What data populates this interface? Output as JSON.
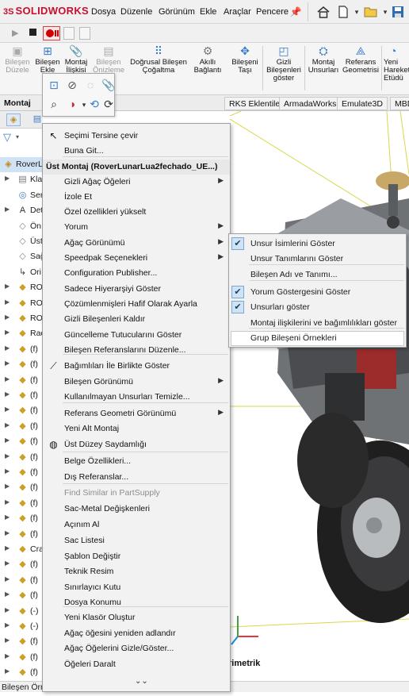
{
  "app": {
    "logo_brand": "SOLIDWORKS",
    "logo_prefix": "3S"
  },
  "menubar": [
    "Dosya",
    "Düzenle",
    "Görünüm",
    "Ekle",
    "Araçlar",
    "Pencere"
  ],
  "commands": [
    {
      "label": "Bileşen Düzele",
      "disabled": true,
      "icon": "component-edit-icon"
    },
    {
      "label": "Bileşen Ekle",
      "disabled": false,
      "icon": "insert-component-icon"
    },
    {
      "label": "Montaj İlişkisi",
      "disabled": false,
      "icon": "mate-icon"
    },
    {
      "label": "Bileşen Önizleme",
      "disabled": true,
      "icon": "preview-icon"
    },
    {
      "label": "Doğrusal Bileşen Çoğaltma",
      "disabled": false,
      "icon": "linear-pattern-icon"
    },
    {
      "label": "Akıllı Bağlantı",
      "disabled": false,
      "icon": "smart-fastener-icon"
    },
    {
      "label": "Bileşeni Taşı",
      "disabled": false,
      "icon": "move-component-icon"
    },
    {
      "label": "Gizli Bileşenleri göster",
      "disabled": false,
      "icon": "show-hidden-icon"
    },
    {
      "label": "Montaj Unsurları",
      "disabled": false,
      "icon": "assembly-feature-icon"
    },
    {
      "label": "Referans Geometrisi",
      "disabled": false,
      "icon": "reference-geometry-icon"
    },
    {
      "label": "Yeni Hareket Etüdü",
      "disabled": false,
      "icon": "motion-study-icon"
    }
  ],
  "tabs": [
    "Montaj",
    "RKS Eklentileri",
    "ArmadaWorks",
    "Emulate3D",
    "MBD"
  ],
  "tree": [
    {
      "label": "RoverL",
      "icon": "assembly-icon",
      "expand": ""
    },
    {
      "label": "Kla",
      "icon": "folder-icon",
      "expand": "▶"
    },
    {
      "label": "Ser",
      "icon": "sensor-icon",
      "expand": ""
    },
    {
      "label": "Det",
      "icon": "annotation-icon",
      "expand": "▶"
    },
    {
      "label": "Ön",
      "icon": "plane-icon",
      "expand": ""
    },
    {
      "label": "Üst",
      "icon": "plane-icon",
      "expand": ""
    },
    {
      "label": "Sağ",
      "icon": "plane-icon",
      "expand": ""
    },
    {
      "label": "Ori",
      "icon": "origin-icon",
      "expand": ""
    },
    {
      "label": "RO",
      "icon": "part-icon",
      "expand": "▶"
    },
    {
      "label": "RO",
      "icon": "part-icon",
      "expand": "▶"
    },
    {
      "label": "RO",
      "icon": "part-icon",
      "expand": "▶"
    },
    {
      "label": "Rac",
      "icon": "part-icon",
      "expand": "▶"
    },
    {
      "label": "(f)",
      "icon": "part-icon",
      "expand": "▶"
    },
    {
      "label": "(f)",
      "icon": "part-icon",
      "expand": "▶"
    },
    {
      "label": "(f)",
      "icon": "part-icon",
      "expand": "▶"
    },
    {
      "label": "(f)",
      "icon": "part-icon",
      "expand": "▶"
    },
    {
      "label": "(f)",
      "icon": "part-icon",
      "expand": "▶"
    },
    {
      "label": "(f)",
      "icon": "part-icon",
      "expand": "▶"
    },
    {
      "label": "(f)",
      "icon": "part-icon",
      "expand": "▶"
    },
    {
      "label": "(f)",
      "icon": "part-icon",
      "expand": "▶"
    },
    {
      "label": "(f)",
      "icon": "part-icon",
      "expand": "▶"
    },
    {
      "label": "(f)",
      "icon": "part-icon",
      "expand": "▶"
    },
    {
      "label": "(f)",
      "icon": "part-icon",
      "expand": "▶"
    },
    {
      "label": "(f)",
      "icon": "part-icon",
      "expand": "▶"
    },
    {
      "label": "(f)",
      "icon": "part-icon",
      "expand": "▶"
    },
    {
      "label": "Cra",
      "icon": "part-icon",
      "expand": "▶"
    },
    {
      "label": "(f)",
      "icon": "part-icon",
      "expand": "▶"
    },
    {
      "label": "(f)",
      "icon": "part-icon",
      "expand": "▶"
    },
    {
      "label": "(f)",
      "icon": "part-icon",
      "expand": "▶"
    },
    {
      "label": "(-)",
      "icon": "part-icon",
      "expand": "▶"
    },
    {
      "label": "(-)",
      "icon": "part-icon",
      "expand": "▶"
    },
    {
      "label": "(f)",
      "icon": "part-icon",
      "expand": "▶"
    },
    {
      "label": "(f)",
      "icon": "part-icon",
      "expand": "▶"
    },
    {
      "label": "(f)",
      "icon": "part-icon",
      "expand": "▶"
    },
    {
      "label": "(f)",
      "icon": "part-icon",
      "expand": "▶"
    }
  ],
  "context_menu": {
    "items": [
      {
        "label": "Seçimi Tersine çevir",
        "icon": "cursor-icon"
      },
      {
        "label": "Buna Git...",
        "icon": ""
      },
      {
        "label": "Üst Montaj (RoverLunarLua2fechado_UE...)",
        "header": true
      },
      {
        "label": "Gizli Ağaç Öğeleri",
        "arrow": true
      },
      {
        "label": "İzole Et"
      },
      {
        "label": "Özel özellikleri yükselt"
      },
      {
        "label": "Yorum",
        "arrow": true
      },
      {
        "label": "Ağaç Görünümü",
        "arrow": true
      },
      {
        "label": "Speedpak Seçenekleri",
        "arrow": true
      },
      {
        "label": "Configuration Publisher..."
      },
      {
        "label": "Sadece Hiyerarşiyi Göster"
      },
      {
        "label": "Çözümlenmişleri Hafif Olarak Ayarla"
      },
      {
        "label": "Gizli Bileşenleri Kaldır"
      },
      {
        "label": "Güncelleme Tutucularını Göster"
      },
      {
        "label": "Bileşen Referanslarını Düzenle..."
      },
      {
        "label": "Bağımlıları İle Birlikte Göster",
        "icon": "relations-icon"
      },
      {
        "label": "Bileşen Görünümü",
        "arrow": true
      },
      {
        "label": "Kullanılmayan Unsurları Temizle..."
      },
      {
        "label": "Referans Geometri Görünümü",
        "arrow": true
      },
      {
        "label": "Yeni Alt Montaj"
      },
      {
        "label": "Üst Düzey Saydamlığı",
        "icon": "transparency-icon"
      },
      {
        "label": "Belge Özellikleri..."
      },
      {
        "label": "Dış Referanslar..."
      },
      {
        "label": "Find Similar in PartSupply",
        "disabled": true
      },
      {
        "label": "Sac-Metal Değişkenleri"
      },
      {
        "label": "Açınım Al"
      },
      {
        "label": "Sac Listesi"
      },
      {
        "label": "Şablon Değiştir"
      },
      {
        "label": "Teknik Resim"
      },
      {
        "label": "Sınırlayıcı Kutu"
      },
      {
        "label": "Dosya Konumu"
      },
      {
        "label": "Yeni Klasör Oluştur"
      },
      {
        "label": "Ağaç öğesini yeniden adlandır"
      },
      {
        "label": "Ağaç Öğelerini Gizle/Göster..."
      },
      {
        "label": "Öğeleri Daralt"
      }
    ],
    "more": "⌄⌄"
  },
  "submenu": [
    {
      "label": "Unsur İsimlerini Göster",
      "checked": true
    },
    {
      "label": "Unsur Tanımlarını Göster",
      "checked": false
    },
    {
      "label": "Bileşen Adı ve Tanımı...",
      "checked": false
    },
    {
      "label": "Yorum Göstergesini Göster",
      "checked": true
    },
    {
      "label": "Unsurları göster",
      "checked": true
    },
    {
      "label": "Montaj ilişkilerini ve bağımlılıkları göster",
      "checked": false
    },
    {
      "label": "Grup Bileşeni Örnekleri",
      "checked": false,
      "highlighted": true
    }
  ],
  "viewport": {
    "view_label": "rimetrik"
  },
  "status": {
    "text": "Bileşen Örne"
  },
  "colors": {
    "brand": "#c8102e",
    "accent": "#1f5fa8",
    "axis_x": "#e53935",
    "axis_y": "#43a047",
    "axis_z": "#1e88e5",
    "guide_yellow": "#d8d84a"
  }
}
